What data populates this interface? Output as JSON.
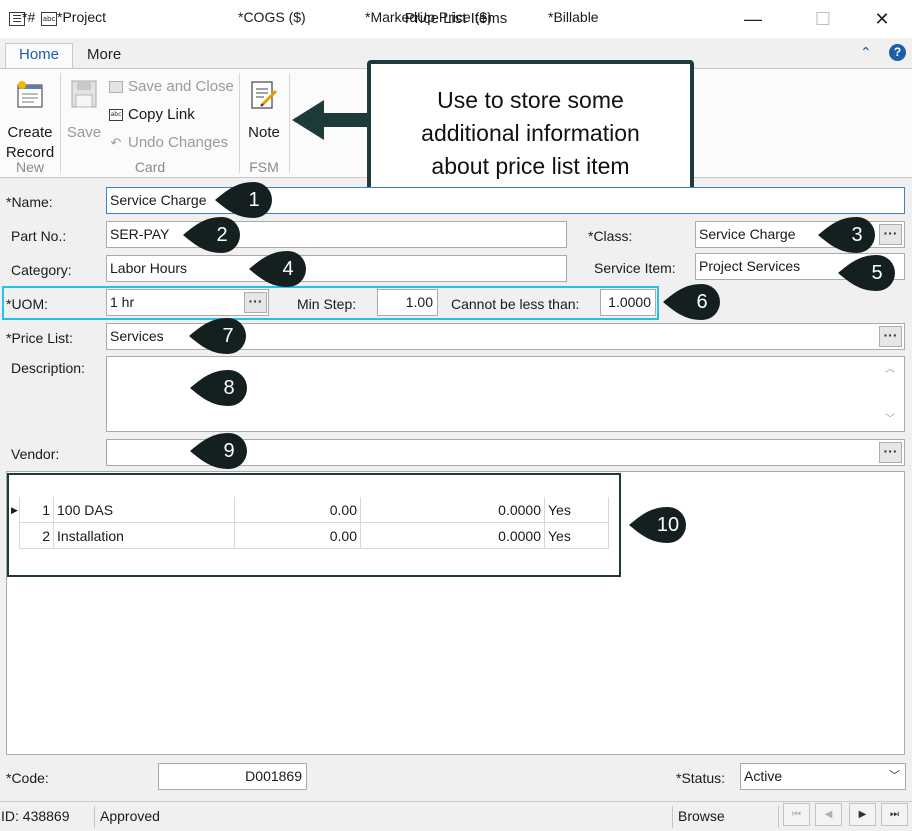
{
  "window": {
    "title": "Price List Items",
    "minimize": "—",
    "maximize": "☐",
    "close": "✕"
  },
  "ribbon": {
    "tabs": [
      {
        "label": "Home",
        "active": true
      },
      {
        "label": "More",
        "active": false
      }
    ],
    "help_glyph": "?",
    "collapse_glyph": "⌃",
    "new_group": {
      "create_record": [
        "Create",
        "Record"
      ],
      "group_label": "New"
    },
    "card_group": {
      "save": "Save",
      "save_and_close": "Save and Close",
      "copy_link": "Copy Link",
      "undo_changes": "Undo Changes",
      "group_label": "Card"
    },
    "fsm_group": {
      "note": "Note",
      "group_label": "FSM"
    }
  },
  "callout": {
    "lines": [
      "Use to store some",
      "additional information",
      "about price list item"
    ]
  },
  "form": {
    "name": {
      "label": "*Name:",
      "value": "Service Charge"
    },
    "part_no": {
      "label": "Part No.:",
      "value": "SER-PAY"
    },
    "class": {
      "label": "*Class:",
      "value": "Service Charge"
    },
    "category": {
      "label": "Category:",
      "value": "Labor Hours"
    },
    "service_item": {
      "label": "Service Item:",
      "value": "Project Services"
    },
    "uom": {
      "label": "*UOM:",
      "value": "1 hr"
    },
    "min_step": {
      "label": "Min Step:",
      "value": "1.00"
    },
    "cannot_be_less": {
      "label": "Cannot be less than:",
      "value": "1.0000"
    },
    "price_list": {
      "label": "*Price List:",
      "value": "Services"
    },
    "description": {
      "label": "Description:",
      "value": ""
    },
    "vendor": {
      "label": "Vendor:",
      "value": ""
    },
    "code": {
      "label": "*Code:",
      "value": "D001869"
    },
    "status": {
      "label": "*Status:",
      "value": "Active"
    },
    "browse_button": "···"
  },
  "grid": {
    "columns": [
      "*#",
      "*Project",
      "*COGS ($)",
      "*MarkedUp Price ($)",
      "*Billable"
    ],
    "rows": [
      {
        "num": "1",
        "project": "100 DAS",
        "cogs": "0.00",
        "price": "0.0000",
        "billable": "Yes"
      },
      {
        "num": "2",
        "project": "Installation",
        "cogs": "0.00",
        "price": "0.0000",
        "billable": "Yes"
      }
    ]
  },
  "markers": [
    "1",
    "2",
    "3",
    "4",
    "5",
    "6",
    "7",
    "8",
    "9",
    "10"
  ],
  "statusbar": {
    "id": "ID: 438869",
    "state": "Approved",
    "mode": "Browse",
    "nav": [
      "⏮",
      "◀",
      "▶",
      "⏭"
    ]
  },
  "colors": {
    "accent_blue": "#1c5fa8",
    "highlight_cyan": "#22c3e6",
    "marker_dark": "#141f1f",
    "callout_border": "#1f3a3a"
  }
}
